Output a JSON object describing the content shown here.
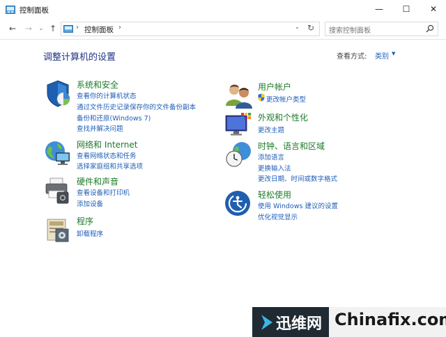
{
  "window": {
    "title": "控制面板",
    "controls": {
      "minimize": "—",
      "maximize": "☐",
      "close": "✕"
    }
  },
  "nav": {
    "back": "←",
    "forward": "→",
    "recent": "⌄",
    "up": "↑",
    "separator": "›",
    "path": "控制面板",
    "dropdown": "⌄",
    "refresh": "↻",
    "search_placeholder": "搜索控制面板"
  },
  "content": {
    "heading": "调整计算机的设置",
    "view_by_label": "查看方式:",
    "view_by_value": "类别",
    "view_by_caret": "▼"
  },
  "categories": [
    {
      "id": "system-security",
      "icon": "shield-icon",
      "title": "系统和安全",
      "links": [
        "查看你的计算机状态",
        "通过文件历史记录保存你的文件备份副本",
        "备份和还原(Windows 7)",
        "查找并解决问题"
      ]
    },
    {
      "id": "network-internet",
      "icon": "globe-network-icon",
      "title": "网络和 Internet",
      "links": [
        "查看网络状态和任务",
        "选择家庭组和共享选项"
      ]
    },
    {
      "id": "hardware-sound",
      "icon": "printer-speaker-icon",
      "title": "硬件和声音",
      "links": [
        "查看设备和打印机",
        "添加设备"
      ]
    },
    {
      "id": "programs",
      "icon": "programs-icon",
      "title": "程序",
      "links": [
        "卸载程序"
      ]
    },
    {
      "id": "user-accounts",
      "icon": "users-icon",
      "title": "用户帐户",
      "links": [
        "更改帐户类型"
      ]
    },
    {
      "id": "appearance",
      "icon": "monitor-palette-icon",
      "title": "外观和个性化",
      "links": [
        "更改主题"
      ]
    },
    {
      "id": "clock-language-region",
      "icon": "clock-globe-icon",
      "title": "时钟、语言和区域",
      "links": [
        "添加语言",
        "更换输入法",
        "更改日期、时间或数字格式"
      ]
    },
    {
      "id": "ease-of-access",
      "icon": "ease-of-access-icon",
      "title": "轻松使用",
      "links": [
        "使用 Windows 建议的设置",
        "优化视觉显示"
      ]
    }
  ],
  "watermark": {
    "brand_cn": "迅维网",
    "brand_en": "Chinafix.com"
  },
  "colors": {
    "link": "#1e5eb8",
    "category_title": "#1c7a2a",
    "heading": "#1e3287"
  }
}
